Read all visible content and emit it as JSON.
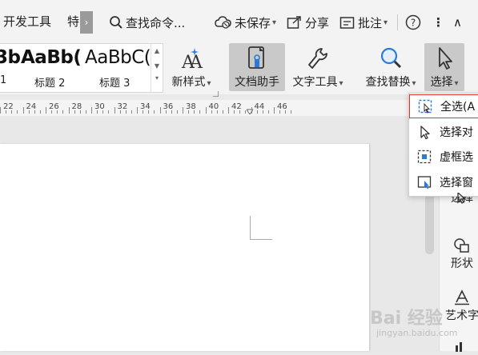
{
  "tabbar": {
    "tabs": [
      "开发工具",
      "特"
    ],
    "more_glyph": "›",
    "search_label": "查找命令...",
    "unsaved_label": "未保存",
    "share_label": "分享",
    "comment_label": "批注",
    "help_glyph": "?",
    "more_menu_glyph": "⋮",
    "collapse_glyph": "∧"
  },
  "ribbon": {
    "styles": [
      {
        "sample": "3b",
        "label": "1"
      },
      {
        "sample": "AaBb(",
        "label": "标题 2"
      },
      {
        "sample": "AaBbC(",
        "label": "标题 3"
      }
    ],
    "new_style_label": "新样式",
    "doc_assistant_label": "文档助手",
    "text_tools_label": "文字工具",
    "find_replace_label": "查找替换",
    "select_label": "选择"
  },
  "ruler": {
    "numbers": [
      "22",
      "24",
      "26",
      "28",
      "30",
      "32",
      "34",
      "36",
      "38",
      "40",
      "42",
      "44",
      "46"
    ]
  },
  "dropdown": {
    "items": [
      {
        "label": "全选(A",
        "icon": "select-all-icon"
      },
      {
        "label": "选择对",
        "icon": "select-object-icon"
      },
      {
        "label": "虚框选",
        "icon": "marquee-select-icon"
      },
      {
        "label": "选择窗",
        "icon": "selection-pane-icon"
      }
    ]
  },
  "side_panel": {
    "items": [
      {
        "label": "选择",
        "icon": "cursor-icon"
      },
      {
        "label": "形状",
        "icon": "shapes-icon"
      },
      {
        "label": "艺术字",
        "icon": "wordart-icon"
      }
    ]
  },
  "watermark": {
    "main": "Bai 经验",
    "sub": "jingyan.baidu.com"
  },
  "colors": {
    "ribbon_bg": "#f3f3f3",
    "active_btn": "#c9c9c9",
    "accent_blue": "#2b7bd6",
    "highlight_red": "#dd3333"
  }
}
